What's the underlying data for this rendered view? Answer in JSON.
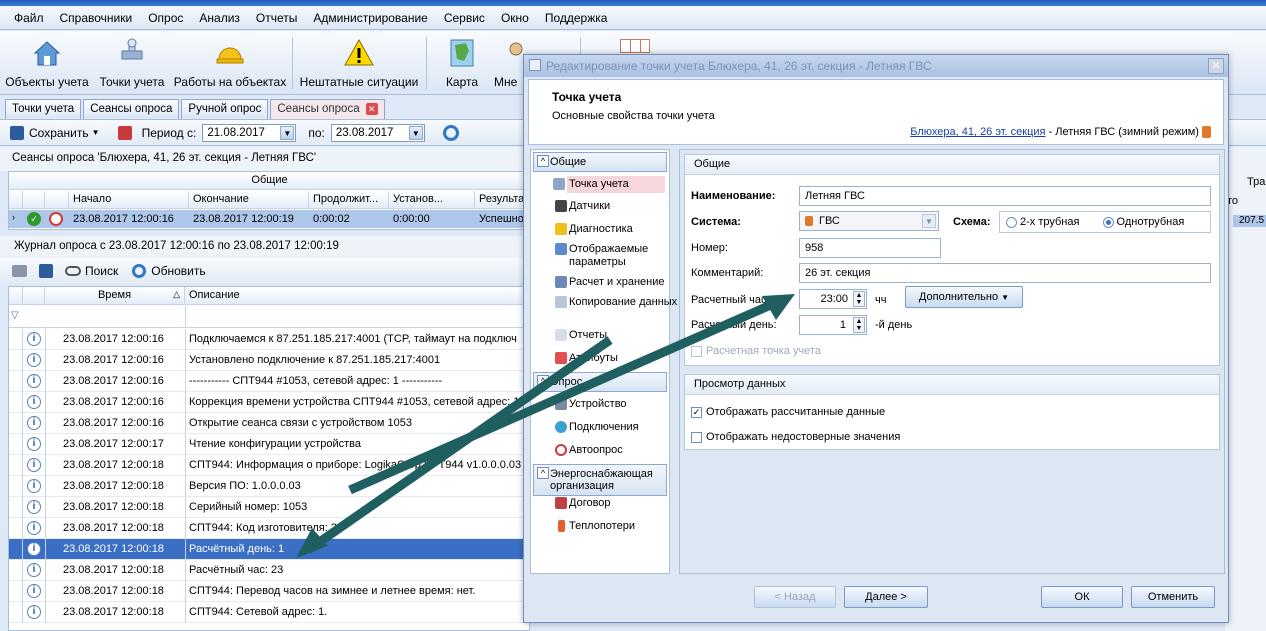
{
  "menu": [
    "Файл",
    "Справочники",
    "Опрос",
    "Анализ",
    "Отчеты",
    "Администрирование",
    "Сервис",
    "Окно",
    "Поддержка"
  ],
  "ribbon": {
    "objects": "Объекты учета",
    "points": "Точки учета",
    "works": "Работы на объектах",
    "emergency": "Нештатные ситуации",
    "map": "Карта",
    "mne": "Мне"
  },
  "tabs": [
    "Точки учета",
    "Сеансы опроса",
    "Ручной опрос",
    "Сеансы опроса"
  ],
  "toolbar": {
    "save": "Сохранить",
    "period_from": "Период с:",
    "date_from": "21.08.2017",
    "period_to": "по:",
    "date_to": "23.08.2017"
  },
  "sessions": {
    "title": "Сеансы опроса 'Блюхера, 41, 26 эт. секция - Летняя ГВС'",
    "group_header": "Общие",
    "right_header": "Тра",
    "right_header2": "то",
    "columns": [
      "Начало",
      "Окончание",
      "Продолжит...",
      "Установ...",
      "Результат"
    ],
    "row": [
      "23.08.2017 12:00:16",
      "23.08.2017 12:00:19",
      "0:00:02",
      "0:00:00",
      "Успешно"
    ],
    "right_value": "207.5"
  },
  "journal": {
    "title": "Журнал опроса с 23.08.2017 12:00:16 по 23.08.2017 12:00:19",
    "search": "Поиск",
    "refresh": "Обновить",
    "col_time": "Время",
    "col_desc": "Описание",
    "rows": [
      {
        "t": "23.08.2017 12:00:16",
        "d": "Подключаемся к 87.251.185.217:4001 (TCP, таймаут на подключ"
      },
      {
        "t": "23.08.2017 12:00:16",
        "d": "Установлено подключение к 87.251.185.217:4001"
      },
      {
        "t": "23.08.2017 12:00:16",
        "d": "----------- СПТ944 #1053, сетевой адрес: 1 -----------"
      },
      {
        "t": "23.08.2017 12:00:16",
        "d": "Коррекция времени устройства СПТ944 #1053, сетевой адрес: 1"
      },
      {
        "t": "23.08.2017 12:00:16",
        "d": "Открытие сеанса связи с устройством 1053"
      },
      {
        "t": "23.08.2017 12:00:17",
        "d": "Чтение конфигурации устройства"
      },
      {
        "t": "23.08.2017 12:00:18",
        "d": "СПТ944: Информация о приборе: LogikaCorp SPT944 v1.0.0.0.03"
      },
      {
        "t": "23.08.2017 12:00:18",
        "d": "Версия ПО: 1.0.0.0.03"
      },
      {
        "t": "23.08.2017 12:00:18",
        "d": "Серийный номер: 1053"
      },
      {
        "t": "23.08.2017 12:00:18",
        "d": "СПТ944: Код изготовителя: 2"
      },
      {
        "t": "23.08.2017 12:00:18",
        "d": "Расчётный день: 1"
      },
      {
        "t": "23.08.2017 12:00:18",
        "d": "Расчётный час: 23"
      },
      {
        "t": "23.08.2017 12:00:18",
        "d": "СПТ944: Перевод часов на зимнее и летнее время: нет."
      },
      {
        "t": "23.08.2017 12:00:18",
        "d": "СПТ944: Сетевой адрес: 1."
      }
    ]
  },
  "dialog": {
    "title": "Редактирование точки учета Блюхера, 41, 26 эт. секция - Летняя ГВС",
    "head_title": "Точка учета",
    "head_sub": "Основные свойства точки учета",
    "head_link": "Блюхера, 41, 26 эт. секция",
    "head_rest": " - Летняя ГВС (зимний режим)",
    "nav_general": "Общие",
    "nav_items": [
      "Точка учета",
      "Датчики",
      "Диагностика",
      "Отображаемые параметры",
      "Расчет и хранение",
      "Копирование данных",
      "Отчеты",
      "Атрибуты"
    ],
    "nav_poll": "Опрос",
    "nav_poll_items": [
      "Устройство",
      "Подключения",
      "Автоопрос"
    ],
    "nav_energy": "Энергоснабжающая организация",
    "nav_energy_items": [
      "Договор",
      "Теплопотери"
    ],
    "grp_general": "Общие",
    "name_lbl": "Наименование:",
    "name_val": "Летняя ГВС",
    "system_lbl": "Система:",
    "system_val": "ГВС",
    "scheme_lbl": "Схема:",
    "scheme_opt1": "2-х трубная",
    "scheme_opt2": "Однотрубная",
    "number_lbl": "Номер:",
    "number_val": "958",
    "comment_lbl": "Комментарий:",
    "comment_val": "26 эт. секция",
    "hour_lbl": "Расчетный час:",
    "hour_val": "23:00",
    "hour_unit": "чч",
    "more": "Дополнительно",
    "day_lbl": "Расчетный день:",
    "day_val": "1",
    "day_unit": "-й день",
    "calc_point": "Расчетная точка учета",
    "grp_view": "Просмотр данных",
    "show_calc": "Отображать рассчитанные данные",
    "show_bad": "Отображать недостоверные значения",
    "back": "< Назад",
    "next": "Далее >",
    "ok": "ОК",
    "cancel": "Отменить"
  }
}
